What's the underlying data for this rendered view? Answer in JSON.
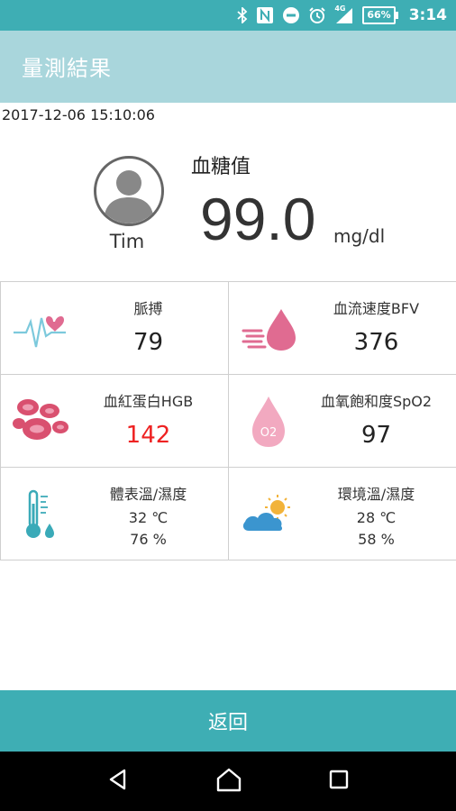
{
  "status_bar": {
    "battery": "66%",
    "time": "3:14",
    "network": "4G",
    "icons": [
      "bluetooth-icon",
      "nfc-icon",
      "do-not-disturb-icon",
      "alarm-icon",
      "signal-icon",
      "battery-icon"
    ]
  },
  "header": {
    "title": "量測結果"
  },
  "measurement": {
    "timestamp": "2017-12-06 15:10:06",
    "user_name": "Tim",
    "glucose_label": "血糖值",
    "glucose_value": "99.0",
    "glucose_unit": "mg/dl"
  },
  "cells": {
    "pulse": {
      "label": "脈搏",
      "value": "79",
      "icon": "heartbeat-icon"
    },
    "bfv": {
      "label": "血流速度BFV",
      "value": "376",
      "icon": "blood-drop-speed-icon"
    },
    "hgb": {
      "label": "血紅蛋白HGB",
      "value": "142",
      "icon": "red-blood-cells-icon",
      "value_color": "#ee2222"
    },
    "spo2": {
      "label": "血氧飽和度SpO2",
      "value": "97",
      "icon": "oxygen-drop-icon",
      "icon_text": "O2"
    },
    "body_temp": {
      "label": "體表溫/濕度",
      "temperature": "32 ℃",
      "humidity": "76 %",
      "icon": "thermometer-icon"
    },
    "env_temp": {
      "label": "環境溫/濕度",
      "temperature": "28 ℃",
      "humidity": "58 %",
      "icon": "weather-icon"
    }
  },
  "footer": {
    "back_label": "返回"
  },
  "colors": {
    "primary": "#3eaeb4",
    "appbar": "#a9d6dc",
    "accent_pink": "#e06b91",
    "alert_red": "#ee2222"
  }
}
